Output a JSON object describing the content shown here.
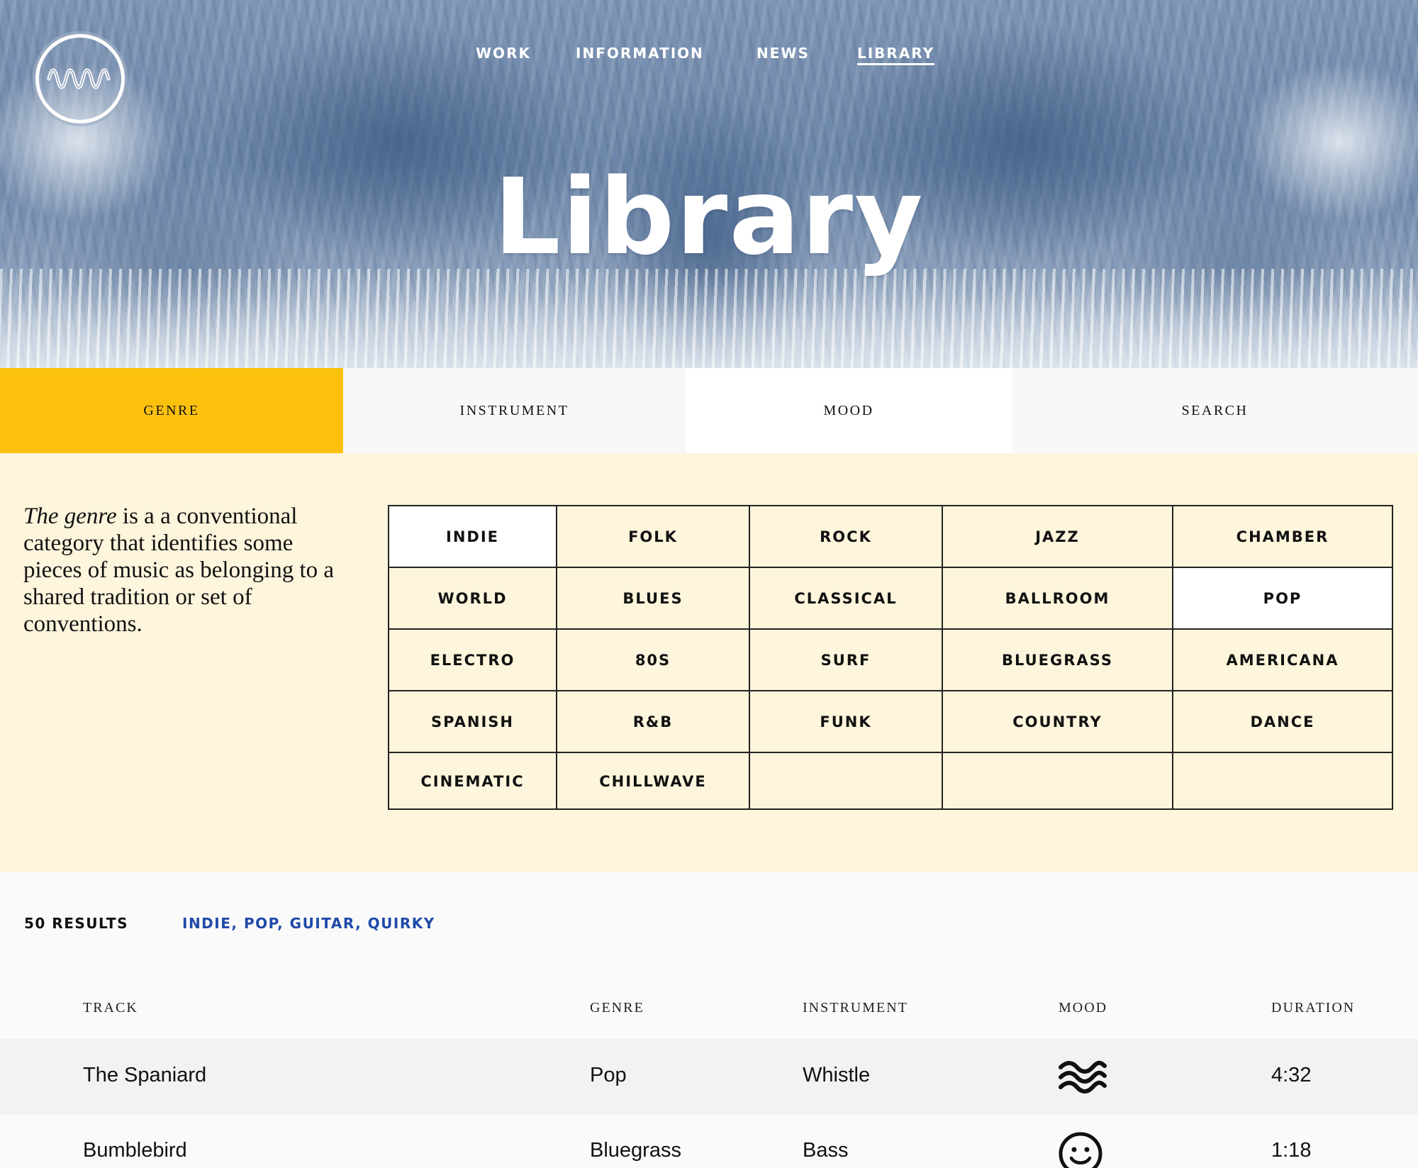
{
  "nav": {
    "items": [
      {
        "label": "WORK",
        "active": false
      },
      {
        "label": "INFORMATION",
        "active": false
      },
      {
        "label": "NEWS",
        "active": false
      },
      {
        "label": "LIBRARY",
        "active": true
      }
    ]
  },
  "hero": {
    "title": "Library"
  },
  "icons": {
    "logo": "wave-logo-icon",
    "mood_waves": "waves-icon",
    "mood_smile": "smiley-icon"
  },
  "tabs": [
    {
      "label": "GENRE",
      "active": true
    },
    {
      "label": "INSTRUMENT",
      "active": false
    },
    {
      "label": "MOOD",
      "active": false
    },
    {
      "label": "SEARCH",
      "active": false
    }
  ],
  "genre_panel": {
    "description_em": "The genre",
    "description_rest": " is a a conventional category that identifies some pieces of music as belonging to a shared tradition or set of conventions.",
    "genres": [
      {
        "label": "INDIE",
        "selected": true
      },
      {
        "label": "FOLK",
        "selected": false
      },
      {
        "label": "ROCK",
        "selected": false
      },
      {
        "label": "JAZZ",
        "selected": false
      },
      {
        "label": "CHAMBER",
        "selected": false
      },
      {
        "label": "WORLD",
        "selected": false
      },
      {
        "label": "BLUES",
        "selected": false
      },
      {
        "label": "CLASSICAL",
        "selected": false
      },
      {
        "label": "BALLROOM",
        "selected": false
      },
      {
        "label": "POP",
        "selected": true
      },
      {
        "label": "ELECTRO",
        "selected": false
      },
      {
        "label": "80S",
        "selected": false
      },
      {
        "label": "SURF",
        "selected": false
      },
      {
        "label": "BLUEGRASS",
        "selected": false
      },
      {
        "label": "AMERICANA",
        "selected": false
      },
      {
        "label": "SPANISH",
        "selected": false
      },
      {
        "label": "R&B",
        "selected": false
      },
      {
        "label": "FUNK",
        "selected": false
      },
      {
        "label": "COUNTRY",
        "selected": false
      },
      {
        "label": "DANCE",
        "selected": false
      },
      {
        "label": "CINEMATIC",
        "selected": false
      },
      {
        "label": "CHILLWAVE",
        "selected": false
      }
    ]
  },
  "results": {
    "count_label": "50 RESULTS",
    "filters_label": "INDIE, POP, GUITAR, QUIRKY"
  },
  "table": {
    "headers": {
      "track": "TRACK",
      "genre": "GENRE",
      "instrument": "INSTRUMENT",
      "mood": "MOOD",
      "duration": "DURATION"
    },
    "rows": [
      {
        "track": "The Spaniard",
        "genre": "Pop",
        "instrument": "Whistle",
        "mood_icon": "waves-icon",
        "duration": "4:32"
      },
      {
        "track": "Bumblebird",
        "genre": "Bluegrass",
        "instrument": "Bass",
        "mood_icon": "smiley-icon",
        "duration": "1:18"
      }
    ]
  }
}
